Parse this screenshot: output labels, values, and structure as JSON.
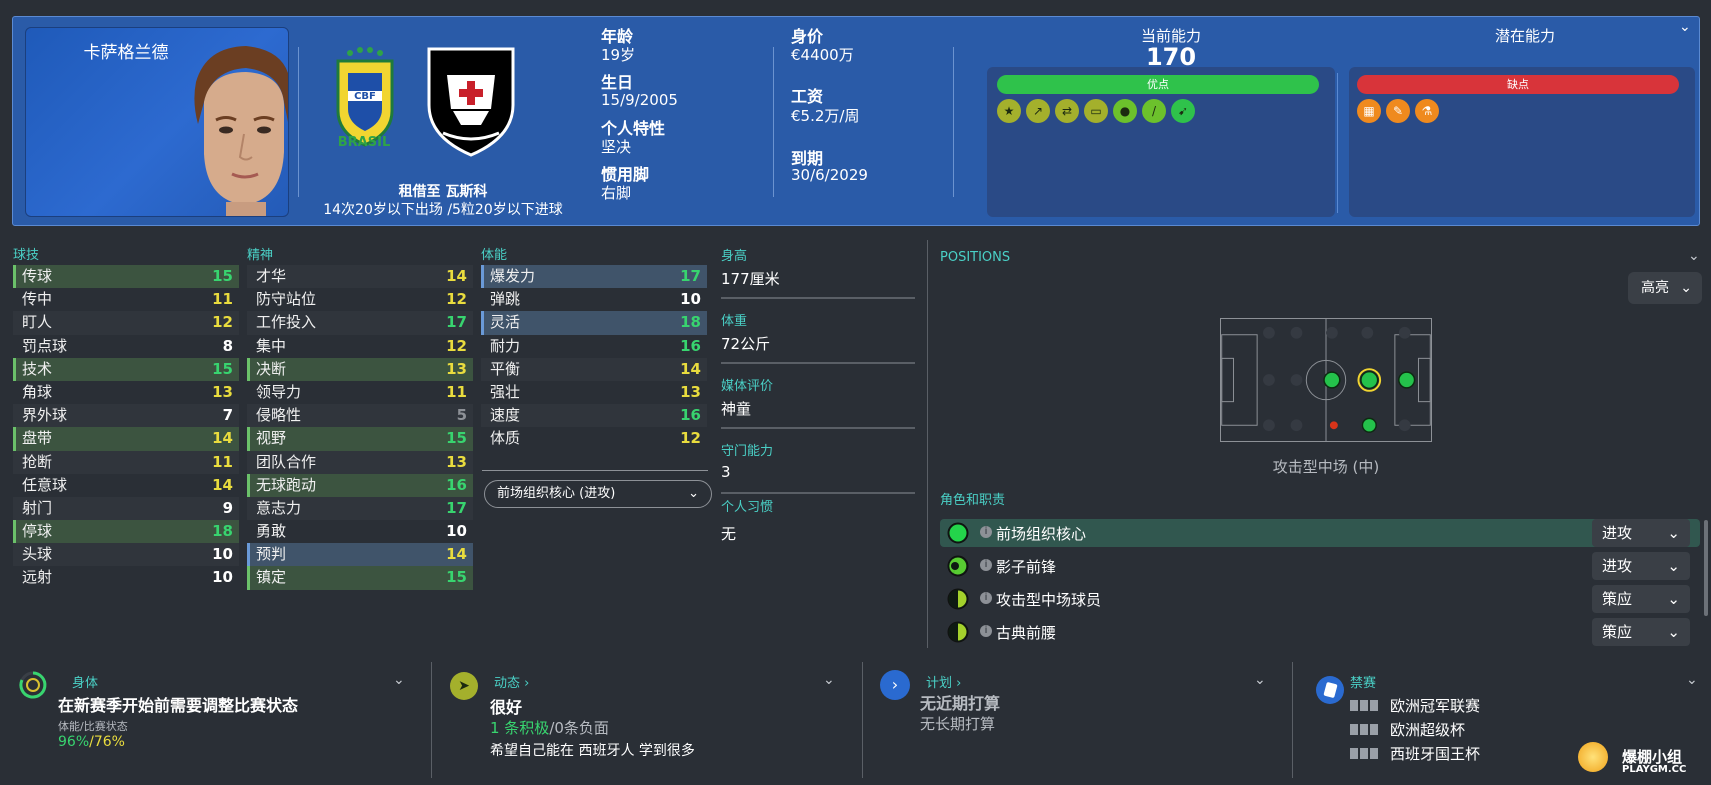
{
  "player": {
    "name": "卡萨格兰德",
    "loan": "租借至 瓦斯科",
    "loan_stats": "14次20岁以下出场 /5粒20岁以下进球"
  },
  "bio": {
    "age_label": "年龄",
    "age": "19岁",
    "dob_label": "生日",
    "dob": "15/9/2005",
    "personality_label": "个人特性",
    "personality": "坚决",
    "foot_label": "惯用脚",
    "foot": "右脚",
    "value_label": "身价",
    "value": "€4400万",
    "wage_label": "工资",
    "wage": "€5.2万/周",
    "expires_label": "到期",
    "expires": "30/6/2029"
  },
  "ability": {
    "ca_label": "当前能力",
    "ca": "170",
    "pa_label": "潜在能力",
    "strengths": "优点",
    "weaknesses": "缺点"
  },
  "colors": {
    "header": "#2a5ba8",
    "green": "#38d46f",
    "yellow": "#e9dc3e",
    "teal": "#4ad0c6",
    "red": "#e43a3a"
  },
  "badges": {
    "national": "BRASIL",
    "national_mark": "CBF"
  },
  "sections": {
    "technical": "球技",
    "mental": "精神",
    "physical": "体能"
  },
  "technical": [
    {
      "n": "传球",
      "v": "15"
    },
    {
      "n": "传中",
      "v": "11"
    },
    {
      "n": "盯人",
      "v": "12"
    },
    {
      "n": "罚点球",
      "v": "8"
    },
    {
      "n": "技术",
      "v": "15"
    },
    {
      "n": "角球",
      "v": "13"
    },
    {
      "n": "界外球",
      "v": "7"
    },
    {
      "n": "盘带",
      "v": "14"
    },
    {
      "n": "抢断",
      "v": "11"
    },
    {
      "n": "任意球",
      "v": "14"
    },
    {
      "n": "射门",
      "v": "9"
    },
    {
      "n": "停球",
      "v": "18"
    },
    {
      "n": "头球",
      "v": "10"
    },
    {
      "n": "远射",
      "v": "10"
    }
  ],
  "mental": [
    {
      "n": "才华",
      "v": "14"
    },
    {
      "n": "防守站位",
      "v": "12"
    },
    {
      "n": "工作投入",
      "v": "17"
    },
    {
      "n": "集中",
      "v": "12"
    },
    {
      "n": "决断",
      "v": "13"
    },
    {
      "n": "领导力",
      "v": "11"
    },
    {
      "n": "侵略性",
      "v": "5"
    },
    {
      "n": "视野",
      "v": "15"
    },
    {
      "n": "团队合作",
      "v": "13"
    },
    {
      "n": "无球跑动",
      "v": "16"
    },
    {
      "n": "意志力",
      "v": "17"
    },
    {
      "n": "勇敢",
      "v": "10"
    },
    {
      "n": "预判",
      "v": "14"
    },
    {
      "n": "镇定",
      "v": "15"
    }
  ],
  "physical": [
    {
      "n": "爆发力",
      "v": "17"
    },
    {
      "n": "弹跳",
      "v": "10"
    },
    {
      "n": "灵活",
      "v": "18"
    },
    {
      "n": "耐力",
      "v": "16"
    },
    {
      "n": "平衡",
      "v": "14"
    },
    {
      "n": "强壮",
      "v": "13"
    },
    {
      "n": "速度",
      "v": "16"
    },
    {
      "n": "体质",
      "v": "12"
    }
  ],
  "role_select": "前场组织核心 (进攻)",
  "info": {
    "height_label": "身高",
    "height": "177厘米",
    "weight_label": "体重",
    "weight": "72公斤",
    "media_label": "媒体评价",
    "media": "神童",
    "gk_label": "守门能力",
    "gk": "3",
    "habits_label": "个人习惯",
    "habits": "无"
  },
  "positions": {
    "title": "POSITIONS",
    "highlight": "高亮",
    "name": "攻击型中场 (中)"
  },
  "roles": {
    "title": "角色和职责",
    "list": [
      {
        "name": "前场组织核心",
        "duty": "进攻",
        "level": 1
      },
      {
        "name": "影子前锋",
        "duty": "进攻",
        "level": 0.8
      },
      {
        "name": "攻击型中场球员",
        "duty": "策应",
        "level": 0.5
      },
      {
        "name": "古典前腰",
        "duty": "策应",
        "level": 0.5
      }
    ]
  },
  "footer": {
    "physical_title": "身体",
    "physical_main": "在新赛季开始前需要调整比赛状态",
    "physical_sub": "体能/比赛状态",
    "fitness": "96%",
    "sharpness": "/76%",
    "dynamics_title": "动态",
    "dynamics_main": "很好",
    "positive": "1 条积极",
    "sep": "/",
    "negative": "0条负面",
    "wish": "希望自己能在 西班牙人 学到很多",
    "plans_title": "计划",
    "plans_main": "无近期打算",
    "plans_sub": "无长期打算",
    "bans_title": "禁赛",
    "bans": [
      "欧洲冠军联赛",
      "欧洲超级杯",
      "西班牙国王杯"
    ],
    "logo": "爆棚小组",
    "logo_url": "PLAYGM.CC"
  }
}
